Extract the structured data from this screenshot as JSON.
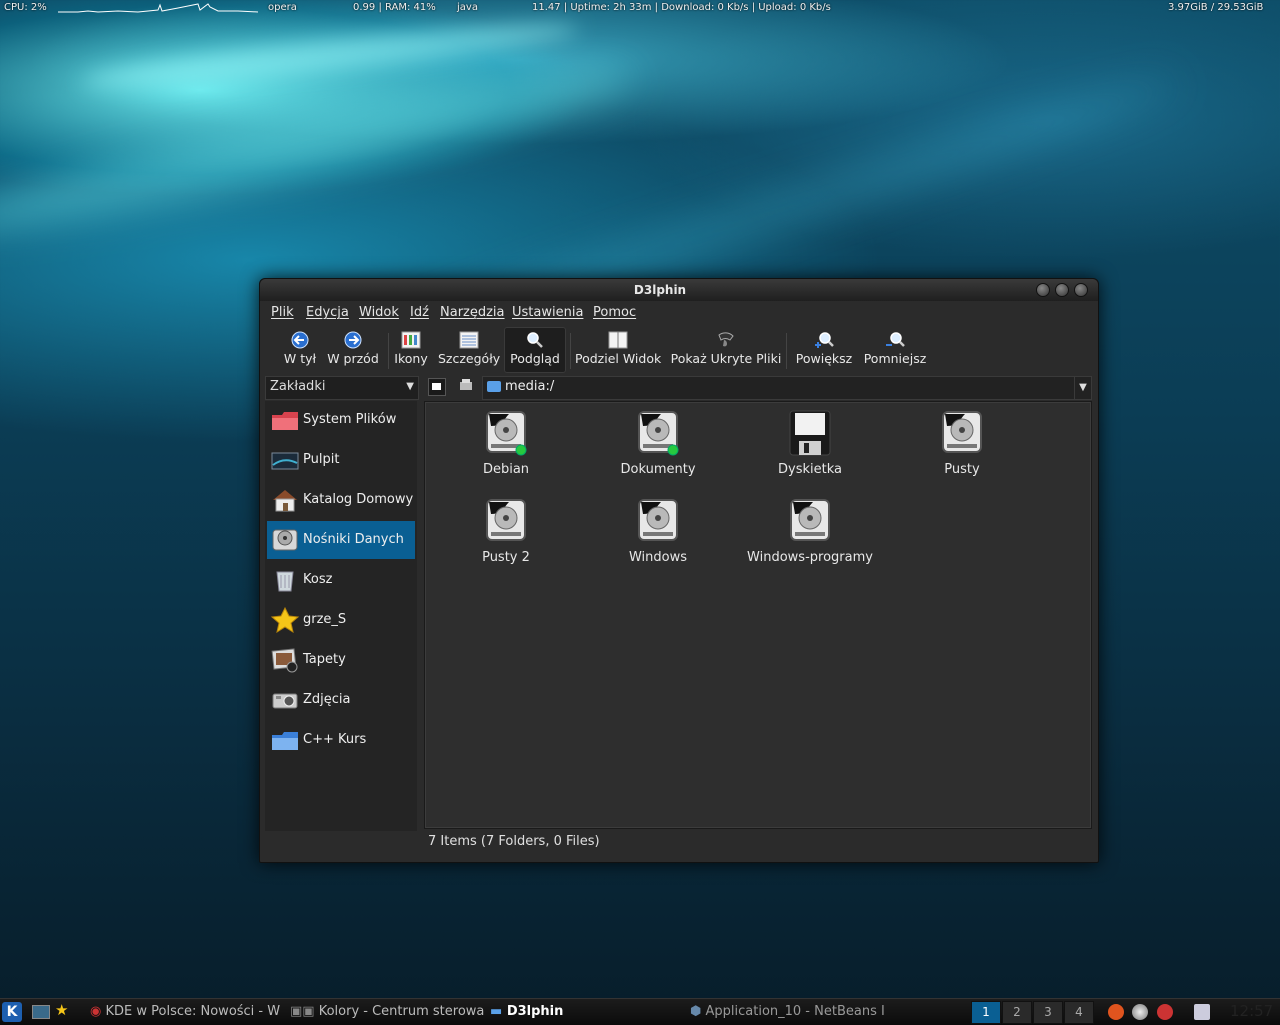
{
  "top_monitor": {
    "cpu": "CPU: 2%",
    "process1": "opera",
    "load_ram": "0.99 | RAM: 41%",
    "process2": "java",
    "time_uptime": "11.47  |  Uptime: 2h 33m  |  Download: 0 Kb/s | Upload: 0 Kb/s",
    "disk": "3.97GiB / 29.53GiB"
  },
  "window": {
    "title": "D3lphin"
  },
  "menu": [
    "Plik",
    "Edycja",
    "Widok",
    "Idź",
    "Narzędzia",
    "Ustawienia",
    "Pomoc"
  ],
  "toolbar": {
    "back": "W tył",
    "forward": "W przód",
    "icons": "Ikony",
    "details": "Szczegóły",
    "preview": "Podgląd",
    "split": "Podziel Widok",
    "hidden": "Pokaż Ukryte Pliki",
    "zoom_in": "Powiększ",
    "zoom_out": "Pomniejsz"
  },
  "bookmarks_select": "Zakładki",
  "location": "media:/",
  "sidebar": [
    {
      "label": "System Plików"
    },
    {
      "label": "Pulpit"
    },
    {
      "label": "Katalog Domowy"
    },
    {
      "label": "Nośniki Danych"
    },
    {
      "label": "Kosz"
    },
    {
      "label": "grze_S"
    },
    {
      "label": "Tapety"
    },
    {
      "label": "Zdjęcia"
    },
    {
      "label": "C++ Kurs"
    }
  ],
  "files": [
    {
      "label": "Debian"
    },
    {
      "label": "Dokumenty"
    },
    {
      "label": "Dyskietka"
    },
    {
      "label": "Pusty"
    },
    {
      "label": "Pusty 2"
    },
    {
      "label": "Windows"
    },
    {
      "label": "Windows-programy"
    }
  ],
  "status": "7 Items (7 Folders, 0 Files)",
  "taskbar": {
    "task1": "KDE w Polsce: Nowości - Wy",
    "task2": "Kolory - Centrum sterowa",
    "task3": "D3lphin",
    "task4": "Application_10 - NetBeans I",
    "desktops": [
      "1",
      "2",
      "3",
      "4"
    ],
    "clock": "12:57"
  },
  "colors": {
    "selection": "#0a5f93",
    "accent_ok": "#27c93f"
  }
}
